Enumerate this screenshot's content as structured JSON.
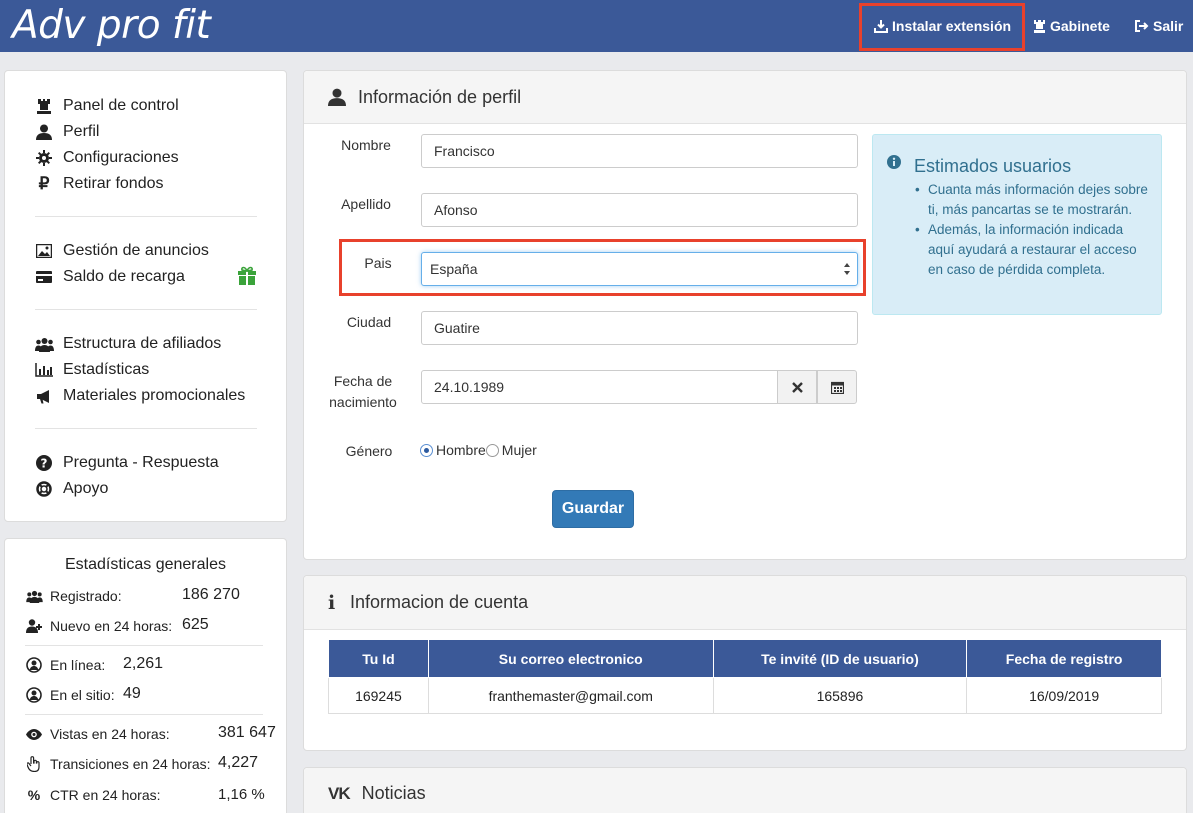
{
  "app": {
    "logo": "Adv pro fit",
    "nav": {
      "install": "Instalar extensión",
      "cabinet": "Gabinete",
      "exit": "Salir"
    }
  },
  "sidebar": {
    "groups": [
      [
        "Panel de control",
        "Perfil",
        "Configuraciones",
        "Retirar fondos"
      ],
      [
        "Gestión de anuncios",
        "Saldo de recarga"
      ],
      [
        "Estructura de afiliados",
        "Estadísticas",
        "Materiales promocionales"
      ],
      [
        "Pregunta - Respuesta",
        "Apoyo"
      ]
    ]
  },
  "stats": {
    "title": "Estadísticas generales",
    "rows": [
      {
        "label": "Registrado:",
        "value": "186 270"
      },
      {
        "label": "Nuevo en 24 horas:",
        "value": "625"
      },
      {
        "label": "En línea:",
        "value": "2,261"
      },
      {
        "label": "En el sitio:",
        "value": "49"
      },
      {
        "label": "Vistas en 24 horas:",
        "value": "381 647"
      },
      {
        "label": "Transiciones en 24 horas:",
        "value": "4,227"
      },
      {
        "label": "CTR en 24 horas:",
        "value": "1,16 %"
      }
    ]
  },
  "profile": {
    "title": "Información de perfil",
    "fields": {
      "nombre": {
        "label": "Nombre",
        "value": "Francisco"
      },
      "apellido": {
        "label": "Apellido",
        "value": "Afonso"
      },
      "pais": {
        "label": "Pais",
        "value": "España"
      },
      "ciudad": {
        "label": "Ciudad",
        "value": "Guatire"
      },
      "fecha": {
        "label_line1": "Fecha de",
        "label_line2": "nacimiento",
        "value": "24.10.1989"
      },
      "genero": {
        "label": "Género",
        "options": [
          "Hombre",
          "Mujer"
        ],
        "selected": "Hombre"
      }
    },
    "save_label": "Guardar",
    "info": {
      "title": "Estimados usuarios",
      "items": [
        "Cuanta más información dejes sobre ti, más pancartas se te mostrarán.",
        "Además, la información indicada aquí ayudará a restaurar el acceso en caso de pérdida completa."
      ]
    }
  },
  "account": {
    "title": "Informacion de cuenta",
    "columns": [
      "Tu Id",
      "Su correo electronico",
      "Te invité (ID de usuario)",
      "Fecha de registro"
    ],
    "row": [
      "169245",
      "franthemaster@gmail.com",
      "165896",
      "16/09/2019"
    ]
  },
  "news": {
    "title": "Noticias"
  },
  "colors": {
    "brand": "#3b5998",
    "highlight": "#e8412c",
    "button": "#337ab7",
    "info_bg": "#d9edf7",
    "gift": "#3aa33a"
  }
}
